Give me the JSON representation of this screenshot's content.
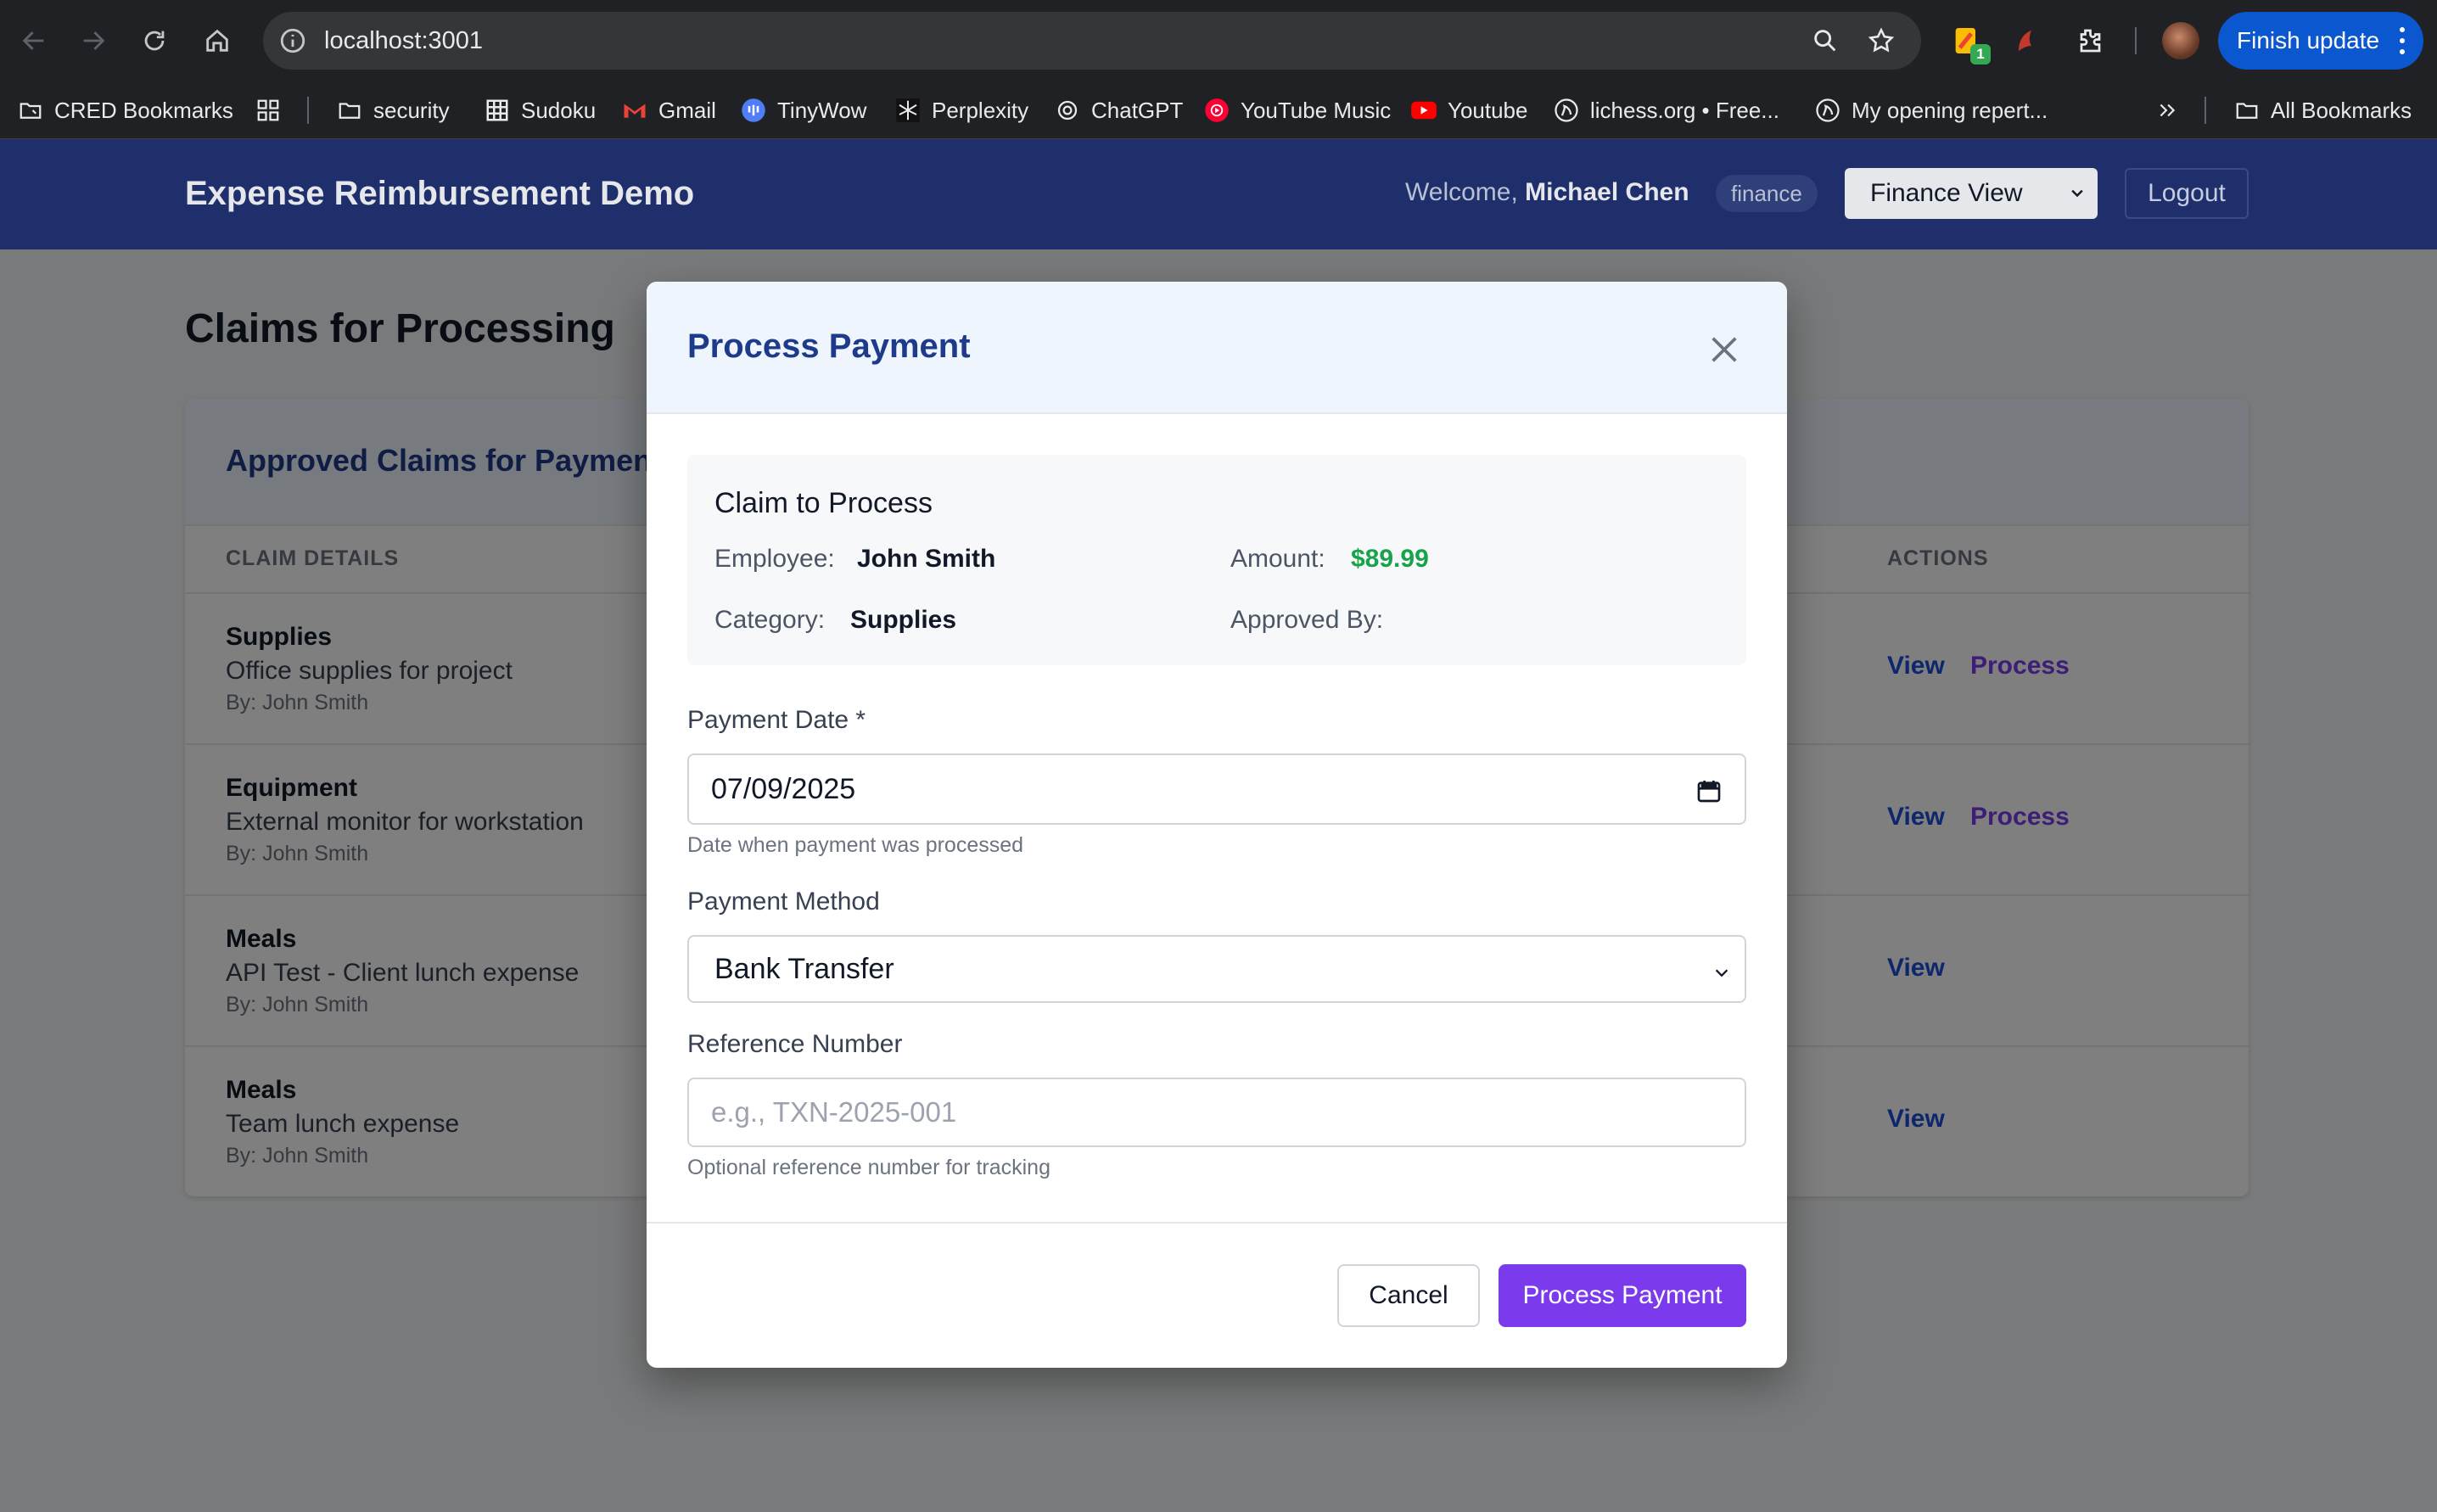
{
  "browser": {
    "url": "localhost:3001",
    "finish_update_label": "Finish update",
    "extension_badge": "1",
    "bookmarks": [
      {
        "label": "CRED Bookmarks",
        "icon": "bookmark-folder-icon"
      },
      {
        "label": "",
        "icon": "apps-grid-icon"
      },
      {
        "label": "security",
        "icon": "folder-icon"
      },
      {
        "label": "Sudoku",
        "icon": "sudoku-icon"
      },
      {
        "label": "Gmail",
        "icon": "gmail-icon"
      },
      {
        "label": "TinyWow",
        "icon": "tinywow-icon"
      },
      {
        "label": "Perplexity",
        "icon": "perplexity-icon"
      },
      {
        "label": "ChatGPT",
        "icon": "chatgpt-icon"
      },
      {
        "label": "YouTube Music",
        "icon": "youtube-music-icon"
      },
      {
        "label": "Youtube",
        "icon": "youtube-icon"
      },
      {
        "label": "lichess.org • Free...",
        "icon": "lichess-icon"
      },
      {
        "label": "My opening repert...",
        "icon": "lichess-icon"
      }
    ],
    "all_bookmarks_label": "All Bookmarks"
  },
  "header": {
    "app_title": "Expense Reimbursement Demo",
    "welcome_prefix": "Welcome, ",
    "user_name": "Michael Chen",
    "role_badge": "finance",
    "view_selected": "Finance View",
    "logout_label": "Logout"
  },
  "page": {
    "title": "Claims for Processing",
    "card_title": "Approved Claims for Payment",
    "columns": [
      "CLAIM DETAILS",
      "ACTIONS"
    ],
    "rows": [
      {
        "category": "Supplies",
        "description": "Office supplies for project",
        "by": "By: John Smith",
        "view": "View",
        "process": "Process"
      },
      {
        "category": "Equipment",
        "description": "External monitor for workstation",
        "by": "By: John Smith",
        "view": "View",
        "process": "Process"
      },
      {
        "category": "Meals",
        "description": "API Test - Client lunch expense",
        "by": "By: John Smith",
        "view": "View",
        "process": ""
      },
      {
        "category": "Meals",
        "description": "Team lunch expense",
        "by": "By: John Smith",
        "view": "View",
        "process": ""
      }
    ]
  },
  "modal": {
    "title": "Process Payment",
    "summary": {
      "title": "Claim to Process",
      "employee_label": "Employee:",
      "employee": "John Smith",
      "amount_label": "Amount:",
      "amount": "$89.99",
      "category_label": "Category:",
      "category": "Supplies",
      "approved_by_label": "Approved By:",
      "approved_by": ""
    },
    "payment_date": {
      "label": "Payment Date *",
      "value": "07/09/2025",
      "help": "Date when payment was processed"
    },
    "payment_method": {
      "label": "Payment Method",
      "value": "Bank Transfer"
    },
    "reference": {
      "label": "Reference Number",
      "placeholder": "e.g., TXN-2025-001",
      "help": "Optional reference number for tracking"
    },
    "cancel_label": "Cancel",
    "submit_label": "Process Payment"
  },
  "colors": {
    "header_bg": "#1e2f6b",
    "primary_purple": "#7c3aed",
    "link_blue": "#1d4ed8",
    "amount_green": "#16a34a",
    "modal_title": "#1e3a8a"
  }
}
